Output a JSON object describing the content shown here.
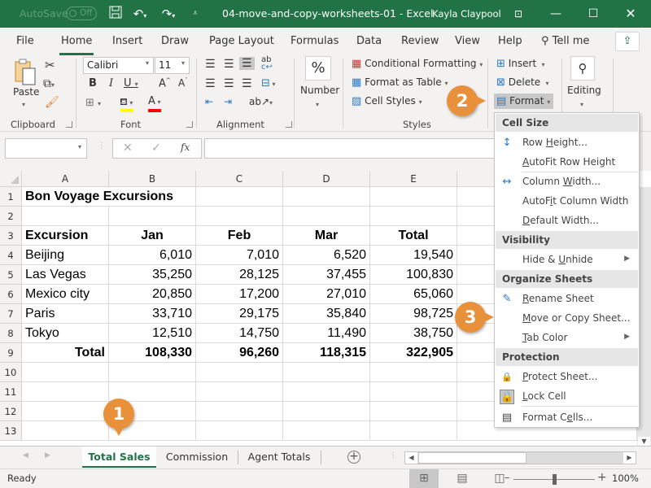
{
  "titlebar": {
    "autosave_label": "AutoSave",
    "autosave_state": "Off",
    "document_title": "04-move-and-copy-worksheets-01  -  Excel",
    "user_name": "Kayla Claypool"
  },
  "ribbon_tabs": [
    "File",
    "Home",
    "Insert",
    "Draw",
    "Page Layout",
    "Formulas",
    "Data",
    "Review",
    "View",
    "Help"
  ],
  "active_tab": "Home",
  "tell_me": "Tell me",
  "ribbon": {
    "clipboard": {
      "label": "Clipboard",
      "paste": "Paste"
    },
    "font": {
      "label": "Font",
      "font_name": "Calibri",
      "font_size": "11",
      "highlight_color": "#ffff00",
      "font_color": "#ff0000"
    },
    "alignment": {
      "label": "Alignment"
    },
    "number": {
      "label": "Number",
      "icon_text": "%"
    },
    "styles": {
      "label": "Styles",
      "conditional_formatting": "Conditional Formatting",
      "format_as_table": "Format as Table",
      "cell_styles": "Cell Styles"
    },
    "cells": {
      "insert": "Insert",
      "delete": "Delete",
      "format": "Format"
    },
    "editing": {
      "label": "Editing"
    }
  },
  "formula_bar": {
    "name_box": "",
    "formula": "",
    "fx_label": "fx"
  },
  "sheet": {
    "columns": [
      "A",
      "B",
      "C",
      "D",
      "E"
    ],
    "rows": [
      "1",
      "2",
      "3",
      "4",
      "5",
      "6",
      "7",
      "8",
      "9",
      "10",
      "11",
      "12",
      "13"
    ],
    "title": "Bon Voyage Excursions",
    "headers": [
      "Excursion",
      "Jan",
      "Feb",
      "Mar",
      "Total"
    ],
    "data": [
      [
        "Beijing",
        "6,010",
        "7,010",
        "6,520",
        "19,540"
      ],
      [
        "Las Vegas",
        "35,250",
        "28,125",
        "37,455",
        "100,830"
      ],
      [
        "Mexico city",
        "20,850",
        "17,200",
        "27,010",
        "65,060"
      ],
      [
        "Paris",
        "33,710",
        "29,175",
        "35,840",
        "98,725"
      ],
      [
        "Tokyo",
        "12,510",
        "14,750",
        "11,490",
        "38,750"
      ]
    ],
    "totals": [
      "Total",
      "108,330",
      "96,260",
      "118,315",
      "322,905"
    ]
  },
  "sheet_tabs": [
    "Total Sales",
    "Commission",
    "Agent Totals"
  ],
  "active_sheet": "Total Sales",
  "status": {
    "text": "Ready",
    "zoom": "100%"
  },
  "format_menu": {
    "sections": [
      {
        "title": "Cell Size",
        "items": [
          {
            "pre": "Row ",
            "u": "H",
            "post": "eight...",
            "icon": "row-height-icon"
          },
          {
            "pre": "",
            "u": "A",
            "post": "utoFit Row Height",
            "icon": ""
          },
          {
            "pre": "Column ",
            "u": "W",
            "post": "idth...",
            "icon": "column-width-icon"
          },
          {
            "pre": "AutoF",
            "u": "i",
            "post": "t Column Width",
            "icon": ""
          },
          {
            "pre": "",
            "u": "D",
            "post": "efault Width...",
            "icon": ""
          }
        ]
      },
      {
        "title": "Visibility",
        "items": [
          {
            "pre": "Hide & ",
            "u": "U",
            "post": "nhide",
            "icon": "",
            "submenu": true
          }
        ]
      },
      {
        "title": "Organize Sheets",
        "items": [
          {
            "pre": "",
            "u": "R",
            "post": "ename Sheet",
            "icon": "rename-sheet-icon"
          },
          {
            "pre": "",
            "u": "M",
            "post": "ove or Copy Sheet...",
            "icon": ""
          },
          {
            "pre": "",
            "u": "T",
            "post": "ab Color",
            "icon": "",
            "submenu": true
          }
        ]
      },
      {
        "title": "Protection",
        "items": [
          {
            "pre": "",
            "u": "P",
            "post": "rotect Sheet...",
            "icon": "protect-sheet-icon"
          },
          {
            "pre": "",
            "u": "L",
            "post": "ock Cell",
            "icon": "lock-icon"
          },
          {
            "pre": "Format C",
            "u": "e",
            "post": "lls...",
            "icon": "format-cells-icon"
          }
        ]
      }
    ]
  },
  "callouts": [
    "1",
    "2",
    "3"
  ],
  "colors": {
    "excel_green": "#217346",
    "callout_orange": "#e8913a"
  }
}
